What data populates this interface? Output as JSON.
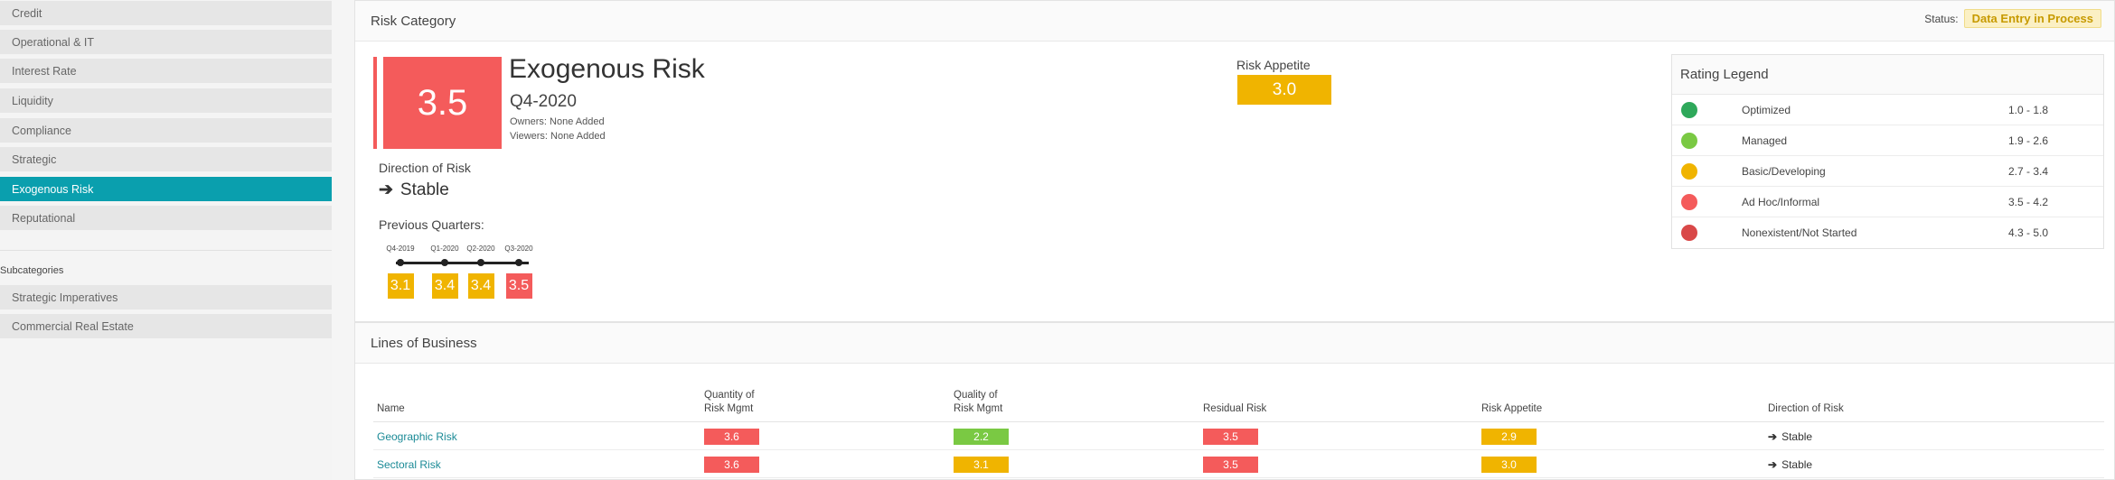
{
  "sidebar": {
    "items": [
      "Credit",
      "Operational & IT",
      "Interest Rate",
      "Liquidity",
      "Compliance",
      "Strategic",
      "Exogenous Risk",
      "Reputational"
    ],
    "active": "Exogenous Risk",
    "subcategories_heading": "Subcategories",
    "subcategories": [
      "Strategic Imperatives",
      "Commercial Real Estate"
    ]
  },
  "risk_category": {
    "panel_title": "Risk Category",
    "status_label": "Status:",
    "status_value": "Data Entry in Process",
    "score": "3.5",
    "score_color": "#f45b5b",
    "name": "Exogenous Risk",
    "quarter": "Q4-2020",
    "owners": "Owners: None Added",
    "viewers": "Viewers: None Added",
    "direction_label": "Direction of Risk",
    "direction_value": "Stable",
    "direction_icon": "arrow-right-icon",
    "previous_label": "Previous Quarters:",
    "previous_quarters": [
      {
        "quarter": "Q4-2019",
        "score": "3.1",
        "color": "#f0b400"
      },
      {
        "quarter": "Q1-2020",
        "score": "3.4",
        "color": "#f0b400"
      },
      {
        "quarter": "Q2-2020",
        "score": "3.4",
        "color": "#f0b400"
      },
      {
        "quarter": "Q3-2020",
        "score": "3.5",
        "color": "#f45b5b"
      }
    ],
    "appetite_label": "Risk Appetite",
    "appetite_value": "3.0",
    "appetite_color": "#f0b400"
  },
  "legend": {
    "title": "Rating Legend",
    "rows": [
      {
        "name": "Optimized",
        "range": "1.0 - 1.8",
        "color": "#2ea85a"
      },
      {
        "name": "Managed",
        "range": "1.9 - 2.6",
        "color": "#7ac943"
      },
      {
        "name": "Basic/Developing",
        "range": "2.7 - 3.4",
        "color": "#f0b400"
      },
      {
        "name": "Ad Hoc/Informal",
        "range": "3.5 - 4.2",
        "color": "#f45b5b"
      },
      {
        "name": "Nonexistent/Not Started",
        "range": "4.3 - 5.0",
        "color": "#d94848"
      }
    ]
  },
  "lob": {
    "panel_title": "Lines of Business",
    "headers": {
      "name": "Name",
      "quantity_line1": "Quantity of",
      "quantity_line2": "Risk Mgmt",
      "quality_line1": "Quality of",
      "quality_line2": "Risk Mgmt",
      "residual": "Residual Risk",
      "appetite": "Risk Appetite",
      "direction": "Direction of Risk"
    },
    "rows": [
      {
        "name": "Geographic Risk",
        "quantity": {
          "value": "3.6",
          "color": "#f45b5b"
        },
        "quality": {
          "value": "2.2",
          "color": "#7ac943"
        },
        "residual": {
          "value": "3.5",
          "color": "#f45b5b"
        },
        "appetite": {
          "value": "2.9",
          "color": "#f0b400"
        },
        "direction": "Stable"
      },
      {
        "name": "Sectoral Risk",
        "quantity": {
          "value": "3.6",
          "color": "#f45b5b"
        },
        "quality": {
          "value": "3.1",
          "color": "#f0b400"
        },
        "residual": {
          "value": "3.5",
          "color": "#f45b5b"
        },
        "appetite": {
          "value": "3.0",
          "color": "#f0b400"
        },
        "direction": "Stable"
      }
    ]
  }
}
